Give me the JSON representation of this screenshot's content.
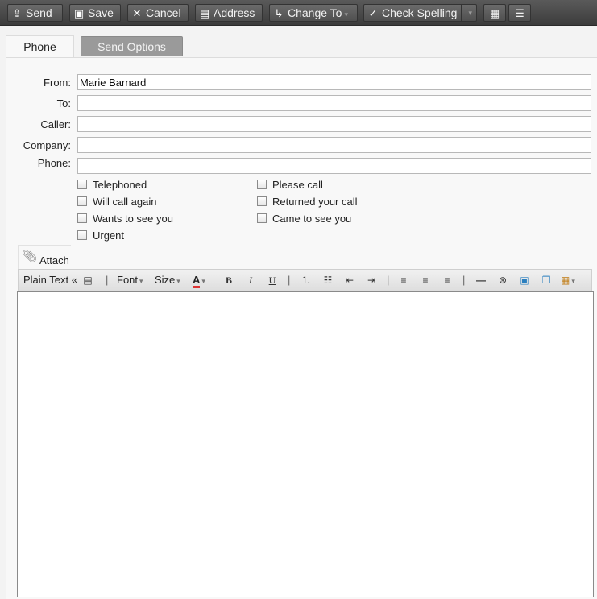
{
  "toolbar": {
    "send": "Send",
    "save": "Save",
    "cancel": "Cancel",
    "address": "Address",
    "change_to": "Change To",
    "check_spelling": "Check Spelling"
  },
  "tabs": {
    "phone": "Phone",
    "send_options": "Send Options"
  },
  "form": {
    "from_label": "From:",
    "from_value": "Marie Barnard",
    "to_label": "To:",
    "to_value": "",
    "caller_label": "Caller:",
    "caller_value": "",
    "company_label": "Company:",
    "company_value": "",
    "phone_label": "Phone:",
    "phone_value": ""
  },
  "checkboxes": {
    "telephoned": "Telephoned",
    "will_call_again": "Will call again",
    "wants_to_see_you": "Wants to see you",
    "urgent": "Urgent",
    "please_call": "Please call",
    "returned_your_call": "Returned your call",
    "came_to_see_you": "Came to see you"
  },
  "attach": "Attach",
  "editor_toolbar": {
    "plain_text": "Plain Text «",
    "font": "Font",
    "size": "Size"
  },
  "colors": {
    "toolbar_bg": "#4a4a4a",
    "tab_inactive": "#9a9a9a"
  }
}
